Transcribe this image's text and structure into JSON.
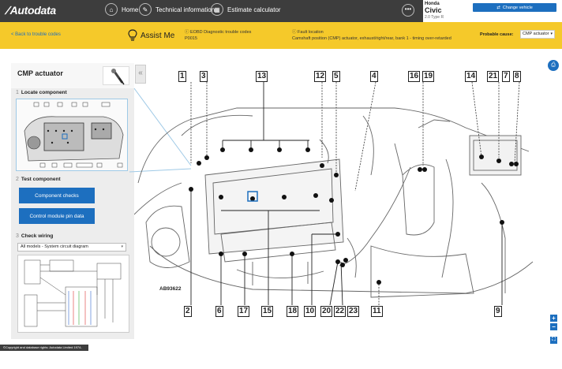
{
  "header": {
    "logo": "Autodata",
    "nav": [
      {
        "label": "Home",
        "icon": "home-icon"
      },
      {
        "label": "Technical information",
        "icon": "wrench-icon"
      },
      {
        "label": "Estimate calculator",
        "icon": "calculator-icon"
      }
    ],
    "more_icon": "more-icon",
    "vehicle": {
      "make": "Honda",
      "model": "Civic",
      "variant": "2.0 Type R",
      "change_label": "Change vehicle"
    }
  },
  "toolbar": {
    "back_label": "< Back to trouble codes",
    "assist_label": "Assist Me",
    "code_heading": "EOBD Diagnostic trouble codes",
    "code": "P0015",
    "fault_heading": "Fault location",
    "fault_text": "Camshaft position (CMP) actuator, exhaust/right/rear, bank 1 - timing over-retarded",
    "probable_label": "Probable cause:",
    "probable_value": "CMP actuator"
  },
  "sidebar": {
    "title": "CMP actuator",
    "steps": [
      {
        "num": "1",
        "label": "Locate component"
      },
      {
        "num": "2",
        "label": "Test component"
      },
      {
        "num": "3",
        "label": "Check wiring"
      }
    ],
    "buttons": [
      "Component checks",
      "Control module pin data"
    ],
    "wiring_select": "All models - System circuit diagram"
  },
  "diagram": {
    "reference": "AB93622",
    "callouts": [
      "1",
      "3",
      "13",
      "12",
      "5",
      "4",
      "16",
      "19",
      "14",
      "21",
      "7",
      "8",
      "2",
      "6",
      "17",
      "15",
      "18",
      "10",
      "20",
      "22",
      "23",
      "11",
      "9"
    ]
  },
  "footer": {
    "copyright": "©Copyright and database rights: Autodata Limited 1974-2018."
  },
  "colors": {
    "accent": "#1d6fbf",
    "topbar": "#3d3d3d",
    "toolbar": "#f5c92a"
  }
}
